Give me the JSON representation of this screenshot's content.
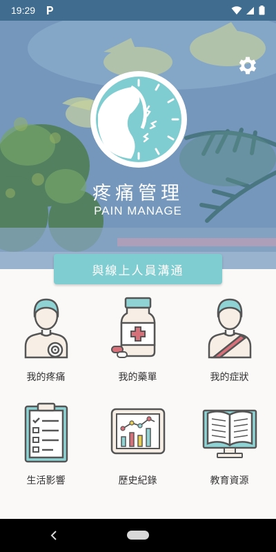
{
  "status_bar": {
    "time": "19:29",
    "notification_icon": "p-icon",
    "icons": [
      "wifi-icon",
      "signal-icon",
      "battery-icon"
    ]
  },
  "header": {
    "title": "疼痛管理",
    "subtitle": "PAIN MANAGE",
    "settings_icon": "gear-icon"
  },
  "contact_button": {
    "label": "與線上人員溝通"
  },
  "menu": {
    "items": [
      {
        "label": "我的疼痛",
        "icon": "person-pain-target-icon"
      },
      {
        "label": "我的藥單",
        "icon": "medicine-bottle-icon"
      },
      {
        "label": "我的症狀",
        "icon": "person-sling-icon"
      },
      {
        "label": "生活影響",
        "icon": "clipboard-checklist-icon"
      },
      {
        "label": "歷史紀錄",
        "icon": "chart-history-icon"
      },
      {
        "label": "教育資源",
        "icon": "open-book-icon"
      }
    ]
  },
  "colors": {
    "accent": "#7fcdd0",
    "icon_stroke": "#555555",
    "icon_teal": "#8fd3d4",
    "icon_skin": "#f7efe6",
    "icon_red": "#d8707a"
  }
}
